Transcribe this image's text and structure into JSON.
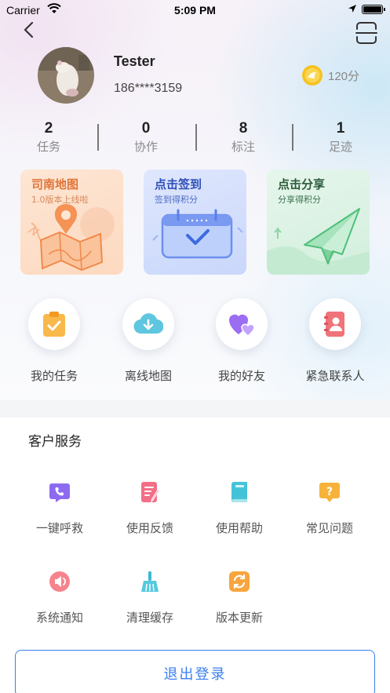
{
  "status_bar": {
    "carrier": "Carrier",
    "time": "5:09 PM"
  },
  "profile": {
    "name": "Tester",
    "phone": "186****3159",
    "points": "120分"
  },
  "stats": [
    {
      "value": "2",
      "label": "任务"
    },
    {
      "value": "0",
      "label": "协作"
    },
    {
      "value": "8",
      "label": "标注"
    },
    {
      "value": "1",
      "label": "足迹"
    }
  ],
  "cards": [
    {
      "title": "司南地图",
      "subtitle": "1.0版本上线啦"
    },
    {
      "title": "点击签到",
      "subtitle": "签到得积分"
    },
    {
      "title": "点击分享",
      "subtitle": "分享得积分"
    }
  ],
  "shortcuts": [
    {
      "label": "我的任务",
      "icon": "clipboard-check-icon"
    },
    {
      "label": "离线地图",
      "icon": "cloud-download-icon"
    },
    {
      "label": "我的好友",
      "icon": "hearts-icon"
    },
    {
      "label": "紧急联系人",
      "icon": "contact-book-icon"
    }
  ],
  "service": {
    "title": "客户服务",
    "items": [
      {
        "label": "一键呼救",
        "icon": "phone-call-icon"
      },
      {
        "label": "使用反馈",
        "icon": "feedback-edit-icon"
      },
      {
        "label": "使用帮助",
        "icon": "help-book-icon"
      },
      {
        "label": "常见问题",
        "icon": "question-mark-icon"
      },
      {
        "label": "系统通知",
        "icon": "speaker-icon"
      },
      {
        "label": "清理缓存",
        "icon": "broom-icon"
      },
      {
        "label": "版本更新",
        "icon": "refresh-icon"
      }
    ]
  },
  "logout_label": "退出登录",
  "colors": {
    "accent": "#3a7ff0",
    "coin": "#f6c21f"
  }
}
